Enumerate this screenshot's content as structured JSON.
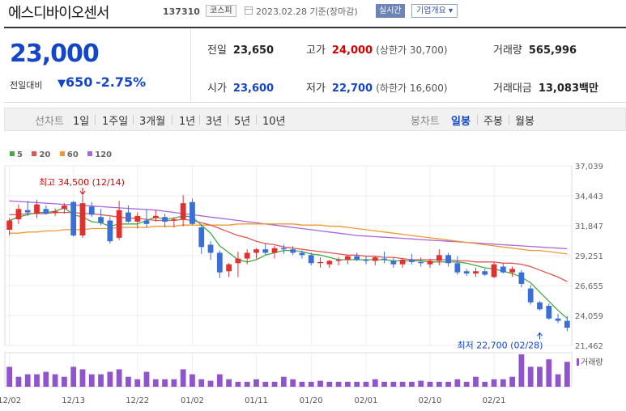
{
  "header": {
    "name": "에스디바이오센서",
    "code": "137310",
    "market": "코스피",
    "date": "2023.02.28  기준(장마감)",
    "realtime": "실시간",
    "company_info": "기업개요"
  },
  "summary": {
    "price": "23,000",
    "change_label": "전일대비",
    "change_value": "650",
    "change_pct": "-2.75%",
    "prev_label": "전일",
    "prev": "23,650",
    "high_label": "고가",
    "high": "24,000",
    "high_limit": "(상한가 30,700)",
    "volume_label": "거래량",
    "volume": "565,996",
    "open_label": "시가",
    "open": "23,600",
    "low_label": "저가",
    "low": "22,700",
    "low_limit": "(하한가 16,600)",
    "amount_label": "거래대금",
    "amount": "13,083",
    "amount_unit": "백만"
  },
  "periods": {
    "line_label": "선차트",
    "line_items": [
      "1일",
      "1주일",
      "3개월",
      "1년",
      "3년",
      "5년",
      "10년"
    ],
    "candle_label": "봉차트",
    "candle_items": [
      "일봉",
      "주봉",
      "월봉"
    ],
    "active": "일봉"
  },
  "colors": {
    "up": "#e03131",
    "down": "#3b6fd8",
    "ma5": "#44aa44",
    "ma20": "#e05555",
    "ma60": "#ee9933",
    "ma120": "#aa66dd",
    "volume": "#9055cc"
  },
  "chart_data": {
    "type": "candlestick",
    "legend": [
      {
        "name": "5",
        "color": "#44aa44"
      },
      {
        "name": "20",
        "color": "#e05555"
      },
      {
        "name": "60",
        "color": "#ee9933"
      },
      {
        "name": "120",
        "color": "#aa66dd"
      }
    ],
    "y_ticks": [
      "37,039",
      "34,443",
      "31,847",
      "29,251",
      "26,655",
      "24,059",
      "21,462"
    ],
    "ylim": [
      21462,
      37039
    ],
    "x_ticks": [
      "12/02",
      "12/13",
      "12/22",
      "01/02",
      "01/11",
      "01/20",
      "02/01",
      "02/10",
      "02/21"
    ],
    "x_tick_index": [
      0,
      7,
      14,
      20,
      27,
      33,
      39,
      46,
      53
    ],
    "annotation_high": "최고 34,500 (12/14)",
    "annotation_high_index": 8,
    "annotation_high_value": 34500,
    "annotation_low": "최저 22,700 (02/28)",
    "annotation_low_index": 58,
    "annotation_low_value": 22700,
    "volume_label": "거래량",
    "candles": [
      {
        "o": 31500,
        "h": 32500,
        "l": 31000,
        "c": 32300
      },
      {
        "o": 32400,
        "h": 33700,
        "l": 32000,
        "c": 33300
      },
      {
        "o": 33200,
        "h": 34000,
        "l": 32700,
        "c": 33000
      },
      {
        "o": 32900,
        "h": 34100,
        "l": 32500,
        "c": 33700
      },
      {
        "o": 33300,
        "h": 33600,
        "l": 32800,
        "c": 32900
      },
      {
        "o": 32950,
        "h": 33350,
        "l": 32700,
        "c": 33100
      },
      {
        "o": 33300,
        "h": 33800,
        "l": 32900,
        "c": 33600
      },
      {
        "o": 33900,
        "h": 34000,
        "l": 30900,
        "c": 31000
      },
      {
        "o": 31000,
        "h": 34500,
        "l": 30800,
        "c": 33800
      },
      {
        "o": 33500,
        "h": 33900,
        "l": 32600,
        "c": 32800
      },
      {
        "o": 32600,
        "h": 33300,
        "l": 31900,
        "c": 32100
      },
      {
        "o": 32300,
        "h": 32600,
        "l": 30300,
        "c": 30500
      },
      {
        "o": 30800,
        "h": 34000,
        "l": 30600,
        "c": 33200
      },
      {
        "o": 33000,
        "h": 33600,
        "l": 32100,
        "c": 32200
      },
      {
        "o": 32200,
        "h": 33000,
        "l": 31600,
        "c": 32700
      },
      {
        "o": 32300,
        "h": 33300,
        "l": 31700,
        "c": 32000
      },
      {
        "o": 32500,
        "h": 33200,
        "l": 32200,
        "c": 32700
      },
      {
        "o": 32600,
        "h": 32900,
        "l": 31700,
        "c": 32200
      },
      {
        "o": 32300,
        "h": 32600,
        "l": 31700,
        "c": 32400
      },
      {
        "o": 32400,
        "h": 34500,
        "l": 31800,
        "c": 33800
      },
      {
        "o": 33900,
        "h": 34200,
        "l": 31900,
        "c": 32000
      },
      {
        "o": 31700,
        "h": 31900,
        "l": 29400,
        "c": 30000
      },
      {
        "o": 30200,
        "h": 30500,
        "l": 28900,
        "c": 29500
      },
      {
        "o": 29500,
        "h": 29700,
        "l": 27300,
        "c": 27800
      },
      {
        "o": 27900,
        "h": 28600,
        "l": 27400,
        "c": 28500
      },
      {
        "o": 28600,
        "h": 29600,
        "l": 27400,
        "c": 29000
      },
      {
        "o": 29000,
        "h": 29800,
        "l": 28500,
        "c": 29500
      },
      {
        "o": 29500,
        "h": 29900,
        "l": 29000,
        "c": 29800
      },
      {
        "o": 29800,
        "h": 30300,
        "l": 29300,
        "c": 29500
      },
      {
        "o": 29500,
        "h": 30100,
        "l": 29000,
        "c": 29900
      },
      {
        "o": 29900,
        "h": 30200,
        "l": 29400,
        "c": 29800
      },
      {
        "o": 29800,
        "h": 30100,
        "l": 29300,
        "c": 29500
      },
      {
        "o": 29500,
        "h": 29700,
        "l": 29000,
        "c": 29300
      },
      {
        "o": 29300,
        "h": 29500,
        "l": 28400,
        "c": 28600
      },
      {
        "o": 28600,
        "h": 29100,
        "l": 28200,
        "c": 28700
      },
      {
        "o": 28500,
        "h": 28900,
        "l": 28200,
        "c": 28800
      },
      {
        "o": 28800,
        "h": 29100,
        "l": 28400,
        "c": 28900
      },
      {
        "o": 28900,
        "h": 29300,
        "l": 28500,
        "c": 29200
      },
      {
        "o": 29200,
        "h": 29500,
        "l": 28800,
        "c": 28900
      },
      {
        "o": 28900,
        "h": 29200,
        "l": 28500,
        "c": 28800
      },
      {
        "o": 28800,
        "h": 29200,
        "l": 28400,
        "c": 29100
      },
      {
        "o": 29000,
        "h": 29600,
        "l": 28600,
        "c": 28900
      },
      {
        "o": 28800,
        "h": 29100,
        "l": 28200,
        "c": 28500
      },
      {
        "o": 28500,
        "h": 29000,
        "l": 28200,
        "c": 28900
      },
      {
        "o": 28900,
        "h": 29400,
        "l": 28500,
        "c": 28700
      },
      {
        "o": 28700,
        "h": 29100,
        "l": 28300,
        "c": 28600
      },
      {
        "o": 28500,
        "h": 29000,
        "l": 28200,
        "c": 28800
      },
      {
        "o": 28800,
        "h": 29800,
        "l": 28400,
        "c": 29300
      },
      {
        "o": 29300,
        "h": 29500,
        "l": 28300,
        "c": 28600
      },
      {
        "o": 28600,
        "h": 29200,
        "l": 27600,
        "c": 27800
      },
      {
        "o": 27900,
        "h": 28100,
        "l": 27500,
        "c": 27700
      },
      {
        "o": 27700,
        "h": 28200,
        "l": 27400,
        "c": 27900
      },
      {
        "o": 27900,
        "h": 28100,
        "l": 27500,
        "c": 27600
      },
      {
        "o": 27400,
        "h": 28700,
        "l": 27300,
        "c": 28500
      },
      {
        "o": 28300,
        "h": 28600,
        "l": 27700,
        "c": 27800
      },
      {
        "o": 27800,
        "h": 28300,
        "l": 27400,
        "c": 28100
      },
      {
        "o": 27800,
        "h": 28000,
        "l": 26500,
        "c": 26800
      },
      {
        "o": 26400,
        "h": 26700,
        "l": 25000,
        "c": 25200
      },
      {
        "o": 25200,
        "h": 25300,
        "l": 24500,
        "c": 24600
      },
      {
        "o": 24900,
        "h": 25100,
        "l": 23700,
        "c": 23800
      },
      {
        "o": 23800,
        "h": 24200,
        "l": 23400,
        "c": 23600
      },
      {
        "o": 23600,
        "h": 24000,
        "l": 22700,
        "c": 23000
      }
    ],
    "volume": [
      4.0,
      2.0,
      2.5,
      2.5,
      3.0,
      2.5,
      2.0,
      4.0,
      3.5,
      2.5,
      2.5,
      3.0,
      3.5,
      2.0,
      1.5,
      3.0,
      1.5,
      1.5,
      1.5,
      3.5,
      2.5,
      1.5,
      1.2,
      2.5,
      1.5,
      1.0,
      1.0,
      1.5,
      1.0,
      1.0,
      2.0,
      1.5,
      1.0,
      1.0,
      1.2,
      1.0,
      1.0,
      1.0,
      1.0,
      1.0,
      1.5,
      1.0,
      1.0,
      1.0,
      1.0,
      1.2,
      1.0,
      1.0,
      1.0,
      1.5,
      1.0,
      2.0,
      1.0,
      1.5,
      1.5,
      2.0,
      6.5,
      4.0,
      4.0,
      5.5,
      2.5,
      5.0
    ],
    "ma5": [
      32300,
      32600,
      32800,
      33000,
      33000,
      33100,
      33400,
      32800,
      32600,
      32200,
      32100,
      31800,
      32000,
      32000,
      32000,
      32300,
      32600,
      32400,
      32500,
      32700,
      32600,
      31900,
      31200,
      30100,
      29500,
      28900,
      28700,
      28900,
      29300,
      29500,
      29700,
      29700,
      29600,
      29400,
      29300,
      29100,
      28900,
      28900,
      28900,
      28900,
      28900,
      28900,
      28800,
      28800,
      28800,
      28800,
      28700,
      28700,
      28700,
      28700,
      28600,
      28400,
      28200,
      28100,
      27900,
      27700,
      27400,
      26900,
      26100,
      25300,
      24500,
      23800
    ],
    "ma20": [
      32800,
      32800,
      32900,
      32900,
      32900,
      33000,
      33000,
      33000,
      32900,
      32900,
      32800,
      32700,
      32600,
      32500,
      32500,
      32400,
      32300,
      32300,
      32300,
      32400,
      32300,
      32100,
      31900,
      31600,
      31300,
      31000,
      30800,
      30500,
      30300,
      30200,
      30000,
      29900,
      29800,
      29700,
      29600,
      29500,
      29400,
      29300,
      29300,
      29200,
      29200,
      29100,
      29100,
      29000,
      28900,
      28900,
      28900,
      28900,
      28900,
      28800,
      28800,
      28700,
      28700,
      28700,
      28600,
      28600,
      28500,
      28300,
      28000,
      27700,
      27400,
      27000
    ],
    "ma60": [
      31200,
      31200,
      31300,
      31300,
      31400,
      31400,
      31500,
      31500,
      31500,
      31600,
      31600,
      31600,
      31700,
      31700,
      31700,
      31700,
      31800,
      31800,
      31800,
      31900,
      31900,
      31900,
      31900,
      31900,
      31900,
      32000,
      32000,
      32000,
      32000,
      32000,
      32000,
      32000,
      31900,
      31900,
      31900,
      31800,
      31800,
      31700,
      31600,
      31500,
      31400,
      31300,
      31200,
      31100,
      31000,
      30900,
      30800,
      30700,
      30600,
      30500,
      30400,
      30300,
      30200,
      30100,
      30000,
      29900,
      29800,
      29700,
      29700,
      29600,
      29500,
      29400
    ],
    "ma120": [
      34000,
      33950,
      33900,
      33850,
      33800,
      33750,
      33700,
      33650,
      33600,
      33550,
      33500,
      33450,
      33400,
      33350,
      33300,
      33250,
      33200,
      33100,
      33000,
      32900,
      32800,
      32700,
      32600,
      32500,
      32400,
      32300,
      32200,
      32100,
      32000,
      31900,
      31800,
      31700,
      31600,
      31500,
      31400,
      31300,
      31200,
      31100,
      31000,
      30950,
      30900,
      30850,
      30800,
      30750,
      30700,
      30650,
      30600,
      30550,
      30500,
      30450,
      30400,
      30350,
      30300,
      30250,
      30200,
      30150,
      30100,
      30050,
      30000,
      29950,
      29900,
      29850
    ]
  }
}
